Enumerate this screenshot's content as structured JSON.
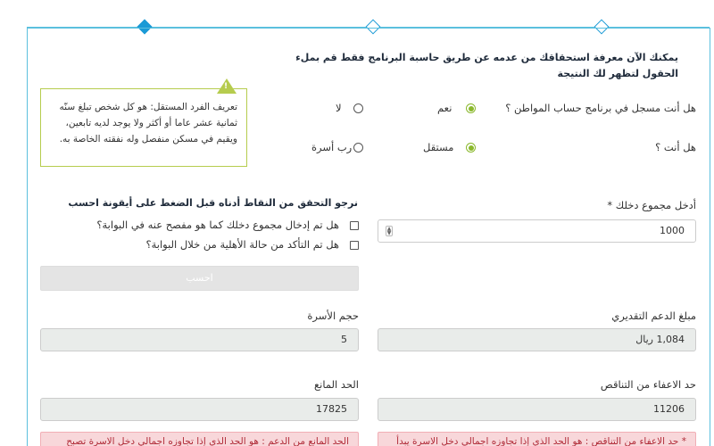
{
  "intro": "يمكنك الآن معرفة استحقاقك من عدمه عن طريق حاسبة البرنامج فقط قم بملء الحقول لتظهر لك النتيجة",
  "q1": {
    "label": "هل أنت مسجل في برنامج حساب المواطن ؟",
    "yes": "نعم",
    "no": "لا",
    "selected": "نعم"
  },
  "q2": {
    "label": "هل أنت ؟",
    "opt1": "مستقل",
    "opt2": "رب أسرة",
    "selected": "مستقل"
  },
  "tooltip": {
    "icon": "warning-icon",
    "text": "تعريف الفرد المستقل: هو كل شخص تبلغ سنّه ثمانية عشر عاما أو أكثر ولا يوجد لديه تابعين، ويقيم في مسكن منفصل وله نفقته الخاصة به."
  },
  "income": {
    "label": "أدخل مجموع دخلك *",
    "value": "1000"
  },
  "checks": {
    "title": "نرجو التحقق من النقاط أدناه قبل الضغط على أيقونة احسب",
    "item1": "هل تم إدخال مجموع دخلك كما هو مفصح عنه في البوابة؟",
    "item2": "هل تم التأكد من حالة الأهلية من خلال البوابة؟"
  },
  "calc_button": "احسب",
  "support": {
    "label": "مبلغ الدعم التقديري",
    "value": "1,084 ريال"
  },
  "family_size": {
    "label": "حجم الأسرة",
    "value": "5"
  },
  "exemption": {
    "label": "حد الاعفاء من التناقص",
    "value": "11206"
  },
  "barrier": {
    "label": "الحد المانع",
    "value": "17825"
  },
  "alerts": {
    "exemption": "* حد الاعفاء من التناقص : هو الحد الذي إذا تجاوزه اجمالي دخل الاسرة يبدأ",
    "barrier": "الحد المانع من الدعم : هو الحد الذي إذا تجاوزه اجمالي دخل الاسرة تصبح الاسرة"
  },
  "colors": {
    "accent": "#1a9ad6",
    "selected": "#8ab82c",
    "alert_bg": "#f8d7da",
    "alert_text": "#b02a37"
  }
}
